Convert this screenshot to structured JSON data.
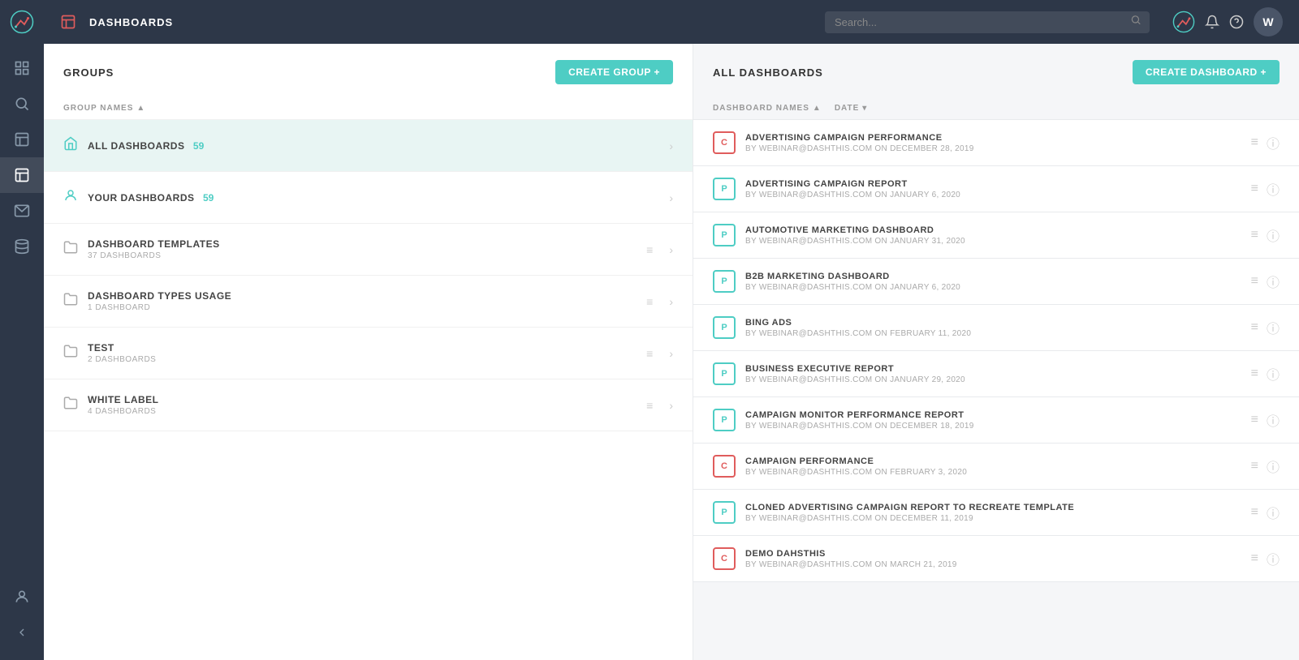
{
  "app": {
    "name": "dashthis",
    "topbar_title": "DASHBOARDS"
  },
  "search": {
    "placeholder": "Search..."
  },
  "sidebar": {
    "items": [
      {
        "id": "dashboard",
        "label": "Dashboard",
        "active": false
      },
      {
        "id": "search",
        "label": "Search",
        "active": false
      },
      {
        "id": "reports",
        "label": "Reports",
        "active": false
      },
      {
        "id": "table",
        "label": "Table",
        "active": true
      },
      {
        "id": "email",
        "label": "Email",
        "active": false
      },
      {
        "id": "data",
        "label": "Data",
        "active": false
      }
    ],
    "bottom": [
      {
        "id": "user",
        "label": "User"
      },
      {
        "id": "collapse",
        "label": "Collapse"
      }
    ]
  },
  "groups_panel": {
    "title": "GROUPS",
    "create_btn": "CREATE GROUP +",
    "column_header": "GROUP NAMES",
    "items": [
      {
        "id": "all-dashboards",
        "name": "ALL DASHBOARDS",
        "count": "59",
        "sub": null,
        "active": true,
        "icon": "home"
      },
      {
        "id": "your-dashboards",
        "name": "YOUR DASHBOARDS",
        "count": "59",
        "sub": null,
        "active": false,
        "icon": "person"
      },
      {
        "id": "dashboard-templates",
        "name": "DASHBOARD TEMPLATES",
        "count": null,
        "sub": "37 DASHBOARDS",
        "active": false,
        "icon": "folder"
      },
      {
        "id": "dashboard-types-usage",
        "name": "DASHBOARD TYPES USAGE",
        "count": null,
        "sub": "1 DASHBOARD",
        "active": false,
        "icon": "folder"
      },
      {
        "id": "test",
        "name": "TEST",
        "count": null,
        "sub": "2 DASHBOARDS",
        "active": false,
        "icon": "folder"
      },
      {
        "id": "white-label",
        "name": "WHITE LABEL",
        "count": null,
        "sub": "4 DASHBOARDS",
        "active": false,
        "icon": "folder"
      }
    ]
  },
  "dashboards_panel": {
    "title": "ALL DASHBOARDS",
    "create_btn": "CREATE DASHBOARD +",
    "col_name": "DASHBOARD NAMES",
    "col_date": "DATE",
    "items": [
      {
        "id": "adv-campaign-perf",
        "icon_type": "red",
        "icon_letter": "C",
        "name": "ADVERTISING CAMPAIGN PERFORMANCE",
        "by": "WEBINAR@DASHTHIS.COM",
        "on": "DECEMBER 28, 2019"
      },
      {
        "id": "adv-campaign-report",
        "icon_type": "teal",
        "icon_letter": "P",
        "name": "ADVERTISING CAMPAIGN REPORT",
        "by": "WEBINAR@DASHTHIS.COM",
        "on": "JANUARY 6, 2020"
      },
      {
        "id": "automotive-marketing",
        "icon_type": "teal",
        "icon_letter": "P",
        "name": "AUTOMOTIVE MARKETING DASHBOARD",
        "by": "WEBINAR@DASHTHIS.COM",
        "on": "JANUARY 31, 2020"
      },
      {
        "id": "b2b-marketing",
        "icon_type": "teal",
        "icon_letter": "P",
        "name": "B2B MARKETING DASHBOARD",
        "by": "WEBINAR@DASHTHIS.COM",
        "on": "JANUARY 6, 2020"
      },
      {
        "id": "bing-ads",
        "icon_type": "teal",
        "icon_letter": "P",
        "name": "BING ADS",
        "by": "WEBINAR@DASHTHIS.COM",
        "on": "FEBRUARY 11, 2020"
      },
      {
        "id": "business-executive-report",
        "icon_type": "teal",
        "icon_letter": "P",
        "name": "BUSINESS EXECUTIVE REPORT",
        "by": "WEBINAR@DASHTHIS.COM",
        "on": "JANUARY 29, 2020"
      },
      {
        "id": "campaign-monitor-perf",
        "icon_type": "teal",
        "icon_letter": "P",
        "name": "CAMPAIGN MONITOR PERFORMANCE REPORT",
        "by": "WEBINAR@DASHTHIS.COM",
        "on": "DECEMBER 18, 2019"
      },
      {
        "id": "campaign-performance",
        "icon_type": "red",
        "icon_letter": "C",
        "name": "CAMPAIGN PERFORMANCE",
        "by": "WEBINAR@DASHTHIS.COM",
        "on": "FEBRUARY 3, 2020"
      },
      {
        "id": "cloned-adv-campaign",
        "icon_type": "teal",
        "icon_letter": "P",
        "name": "CLONED ADVERTISING CAMPAIGN REPORT TO RECREATE TEMPLATE",
        "by": "WEBINAR@DASHTHIS.COM",
        "on": "DECEMBER 11, 2019"
      },
      {
        "id": "demo-dashthis",
        "icon_type": "red",
        "icon_letter": "C",
        "name": "DEMO DAHSTHIS",
        "by": "WEBINAR@DASHTHIS.COM",
        "on": "MARCH 21, 2019"
      }
    ]
  },
  "user_avatar": "W",
  "colors": {
    "teal": "#4ecdc4",
    "red": "#e05c5c",
    "sidebar_bg": "#2d3748"
  }
}
